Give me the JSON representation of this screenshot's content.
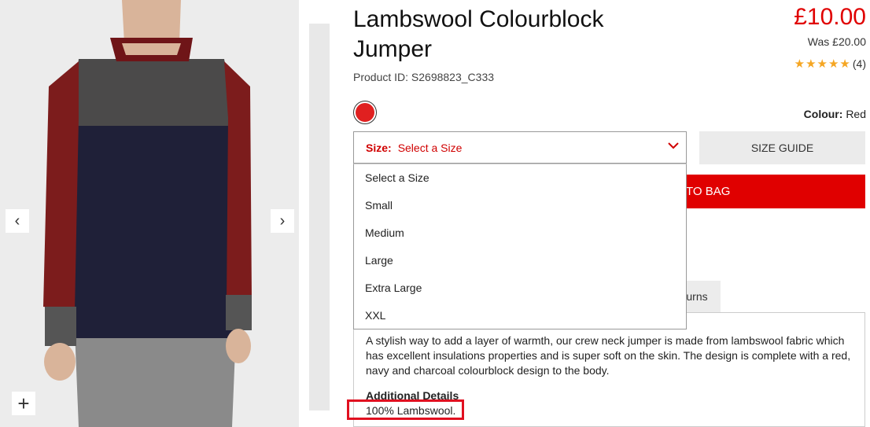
{
  "product": {
    "title": "Lambswool Colourblock Jumper",
    "product_id": "Product ID: S2698823_C333",
    "price": "£10.00",
    "was_price": "Was £20.00",
    "rating_stars": "★★★★★",
    "rating_count": "(4)"
  },
  "gallery": {
    "prev": "‹",
    "next": "›",
    "zoom": "+"
  },
  "colour": {
    "label": "Colour:",
    "value": "Red",
    "swatch_color": "#e02020"
  },
  "size": {
    "label": "Size:",
    "selected": "Select a Size",
    "chevron": "⌄",
    "options": [
      "Select a Size",
      "Small",
      "Medium",
      "Large",
      "Extra Large",
      "XXL"
    ]
  },
  "buttons": {
    "size_guide": "SIZE GUIDE",
    "add_to_bag_visible": "TO BAG"
  },
  "tabs": {
    "returns_visible": "urns"
  },
  "description": {
    "text": "A stylish way to add a layer of warmth, our crew neck jumper is made from lambswool fabric which has excellent insulations properties and is super soft on the skin. The design is complete with a red, navy and charcoal colourblock design to the body.",
    "additional_heading": "Additional Details",
    "composition": "100% Lambswool."
  },
  "colors": {
    "accent": "#e00000",
    "star": "#f5a623"
  }
}
